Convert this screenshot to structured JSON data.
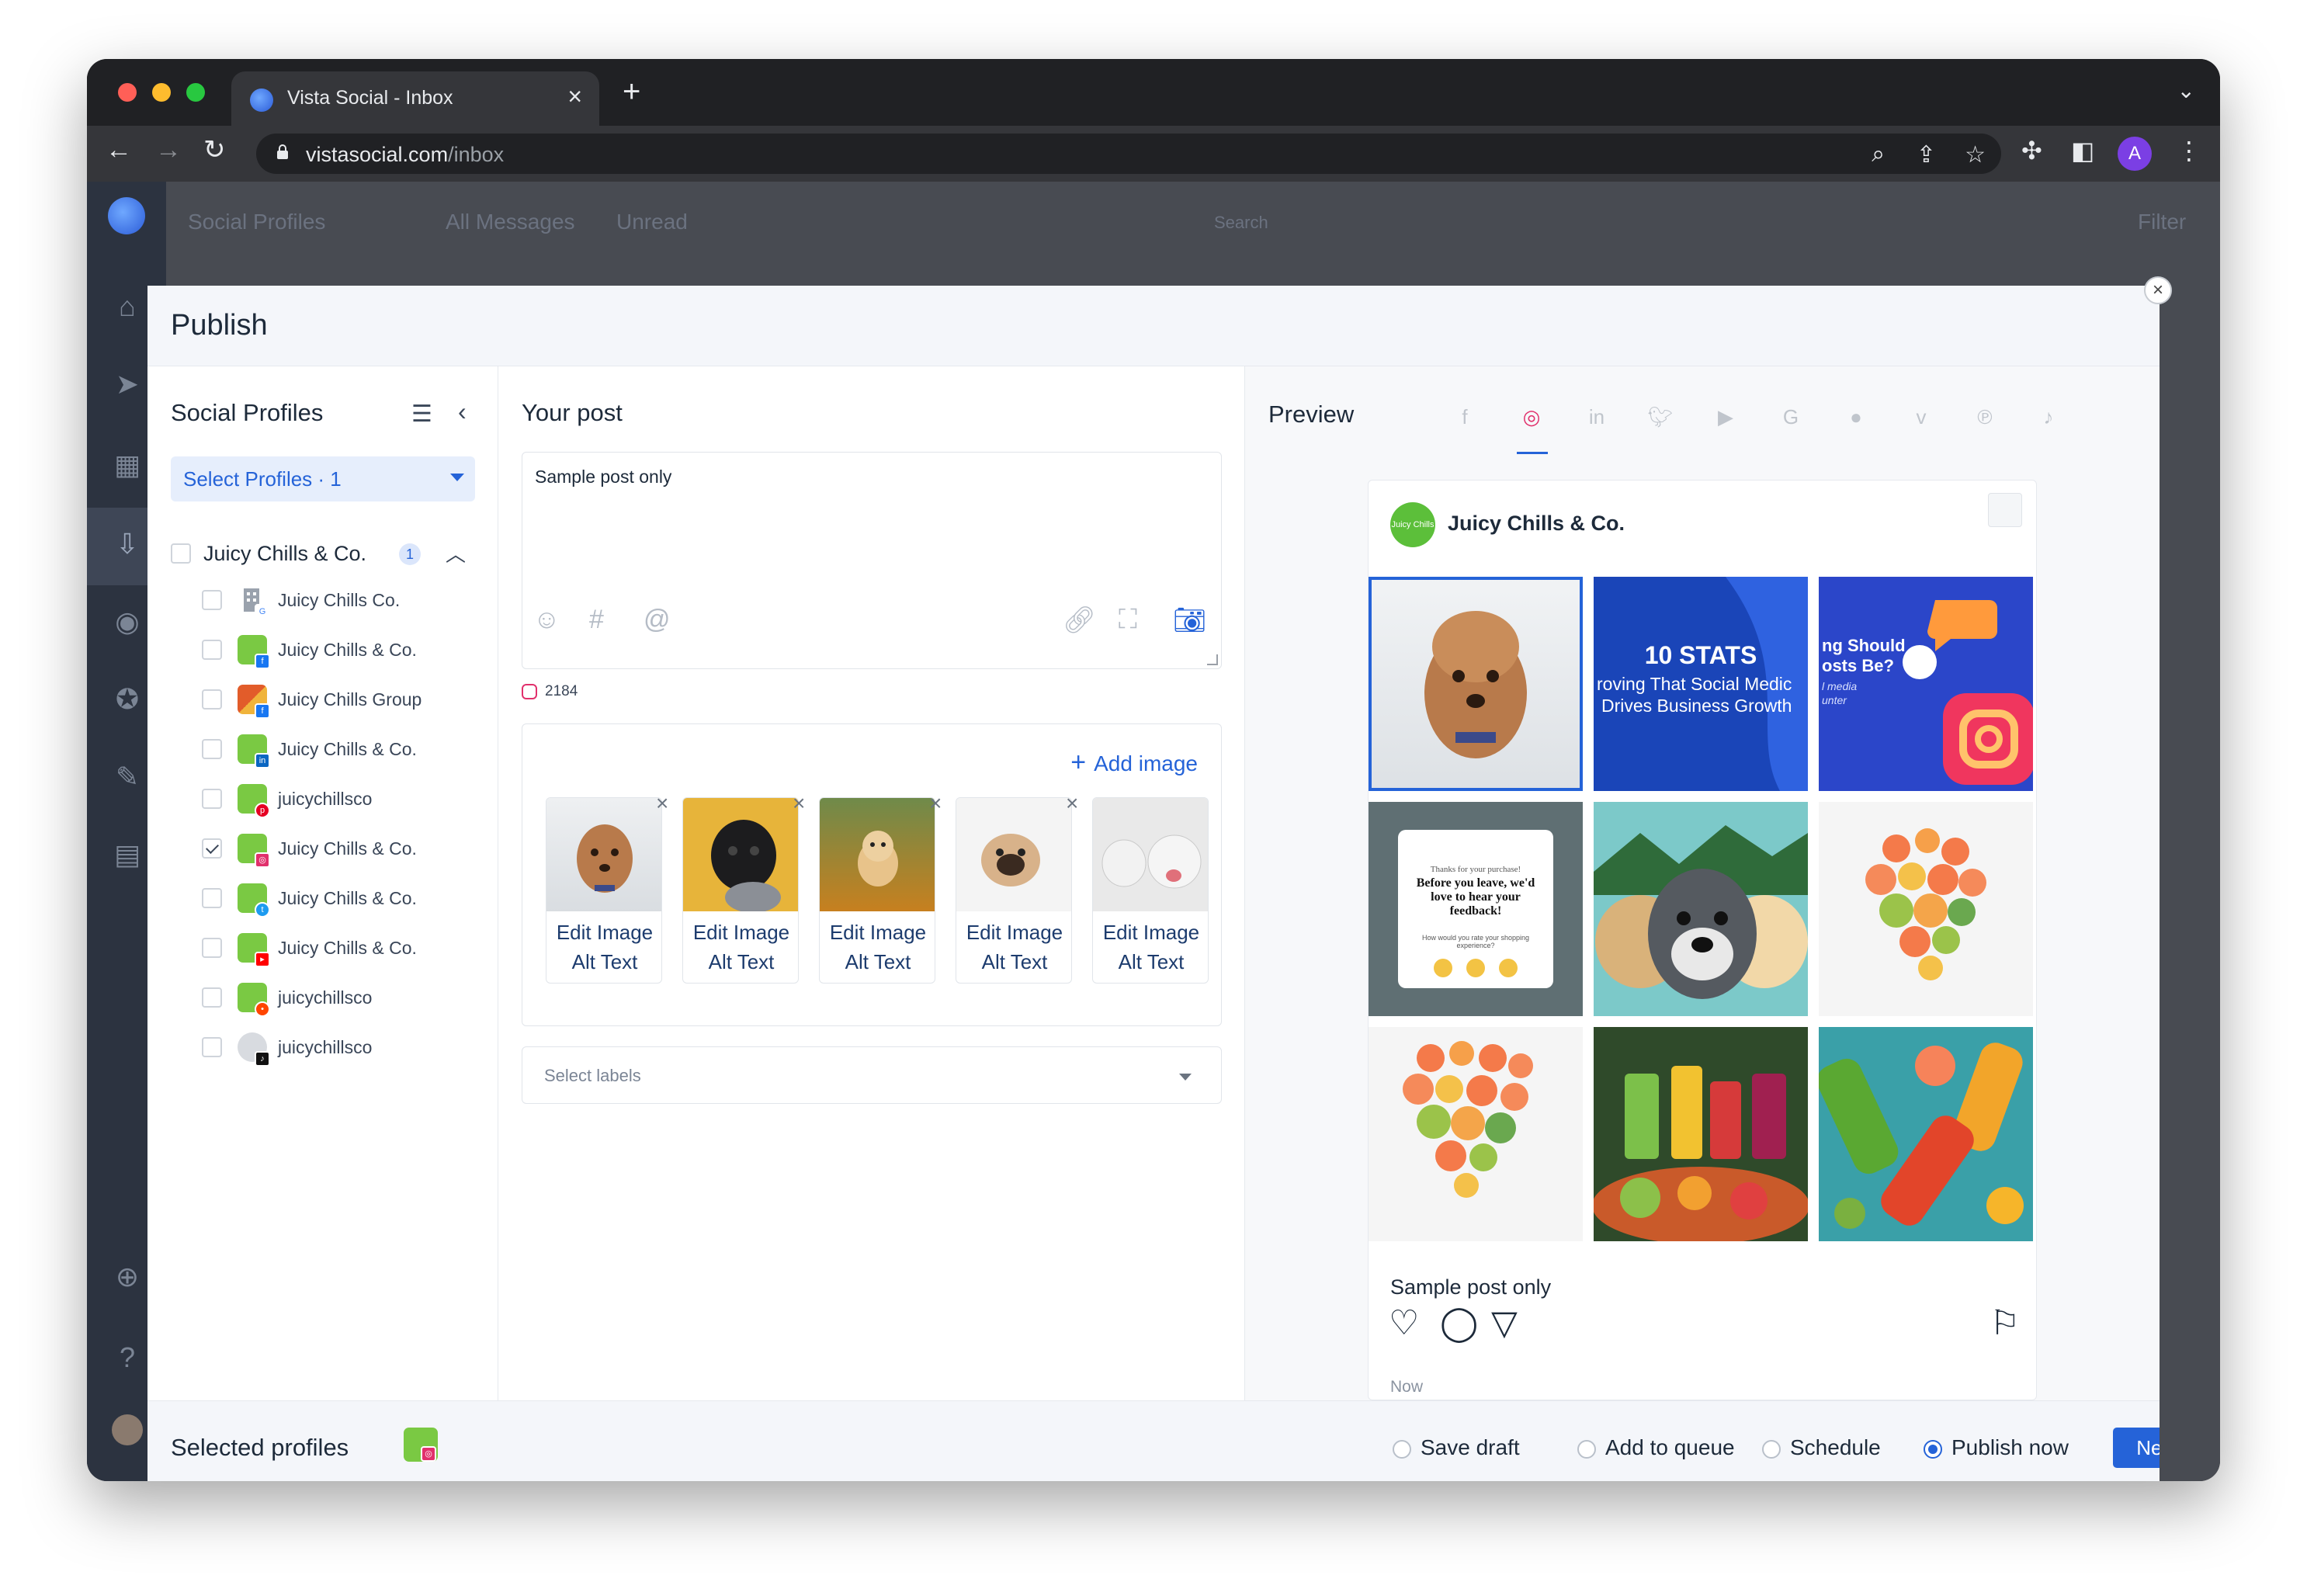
{
  "browser": {
    "tab_title": "Vista Social - Inbox",
    "url_host": "vistasocial.com",
    "url_path": "/inbox",
    "profile_initial": "A"
  },
  "background": {
    "header_left": "Social Profiles",
    "header_tabs": [
      "All Messages",
      "Unread"
    ],
    "search_placeholder": "Search",
    "filter_label": "Filter"
  },
  "modal": {
    "title": "Publish"
  },
  "left": {
    "title": "Social Profiles",
    "select_label": "Select Profiles · 1",
    "group": {
      "name": "Juicy Chills & Co.",
      "count": "1"
    },
    "profiles": [
      {
        "name": "Juicy Chills Co.",
        "network": "google",
        "checked": false
      },
      {
        "name": "Juicy Chills & Co.",
        "network": "facebook",
        "checked": false
      },
      {
        "name": "Juicy Chills Group",
        "network": "facebook",
        "checked": false
      },
      {
        "name": "Juicy Chills & Co.",
        "network": "linkedin",
        "checked": false
      },
      {
        "name": "juicychillsco",
        "network": "pinterest",
        "checked": false
      },
      {
        "name": "Juicy Chills & Co.",
        "network": "instagram",
        "checked": true
      },
      {
        "name": "Juicy Chills & Co.",
        "network": "twitter",
        "checked": false
      },
      {
        "name": "Juicy Chills & Co.",
        "network": "youtube",
        "checked": false
      },
      {
        "name": "juicychillsco",
        "network": "reddit",
        "checked": false
      },
      {
        "name": "juicychillsco",
        "network": "tiktok",
        "checked": false
      }
    ]
  },
  "post": {
    "title": "Your post",
    "text": "Sample post only",
    "char_count": "2184",
    "add_image_label": "Add image",
    "media": [
      {
        "edit_label": "Edit Image",
        "alt_label": "Alt Text"
      },
      {
        "edit_label": "Edit Image",
        "alt_label": "Alt Text"
      },
      {
        "edit_label": "Edit Image",
        "alt_label": "Alt Text"
      },
      {
        "edit_label": "Edit Image",
        "alt_label": "Alt Text"
      },
      {
        "edit_label": "Edit Image",
        "alt_label": "Alt Text"
      }
    ],
    "labels_placeholder": "Select labels"
  },
  "preview": {
    "title": "Preview",
    "networks": [
      "facebook",
      "instagram",
      "linkedin",
      "twitter",
      "youtube",
      "google",
      "reddit",
      "vimeo",
      "pinterest",
      "tiktok"
    ],
    "active_network": "instagram",
    "account_name": "Juicy Chills & Co.",
    "avatar_text": "Juicy Chills",
    "tiles": {
      "stats_title": "10 STATS",
      "stats_line1": "roving That Social Medic",
      "stats_line2": "Drives Business Growth",
      "ig_line1": "ng Should",
      "ig_line2": "osts Be?",
      "ig_line3": "l media",
      "ig_line4": "unter",
      "feedback_small": "Thanks for your purchase!",
      "feedback_main": "Before you leave, we'd love to hear your feedback!",
      "feedback_sub": "How would you rate your shopping experience?"
    },
    "caption": "Sample post only",
    "timestamp": "Now"
  },
  "footer": {
    "selected_label": "Selected profiles",
    "options": [
      {
        "label": "Save draft",
        "selected": false
      },
      {
        "label": "Add to queue",
        "selected": false
      },
      {
        "label": "Schedule",
        "selected": false
      },
      {
        "label": "Publish now",
        "selected": true
      }
    ],
    "next_label": "Next"
  },
  "colors": {
    "accent": "#2563d8",
    "brand_green": "#7ac943",
    "instagram": "#e1306c"
  }
}
